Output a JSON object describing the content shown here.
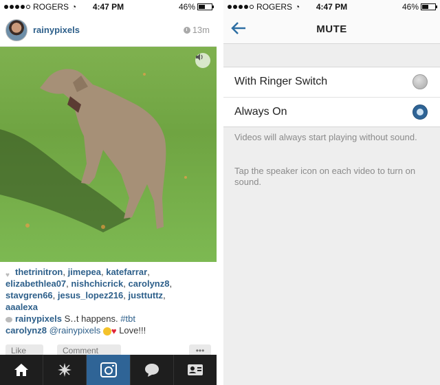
{
  "left_screen": {
    "status_bar": {
      "carrier": "ROGERS",
      "time": "4:47 PM",
      "battery": "46%"
    },
    "post": {
      "username": "rainypixels",
      "age": "13m",
      "likers": [
        "thetrinitron",
        "jimepea",
        "katefarrar",
        "elizabethlea07",
        "nishchicrick",
        "carolynz8",
        "stavgren66",
        "jesus_lopez216",
        "justtuttz",
        "aaalexa"
      ],
      "comments": [
        {
          "user": "rainypixels",
          "text": "S‥t happens.",
          "hashtag": "#tbt"
        },
        {
          "user": "carolynz8",
          "mention": "@rainypixels",
          "text": "Love!!!"
        }
      ],
      "actions": {
        "like": "Like",
        "comment": "Comment",
        "more": "•••"
      }
    },
    "tab_bar": [
      "home-icon",
      "explore-icon",
      "camera-icon",
      "activity-icon",
      "profile-icon"
    ],
    "active_tab": "camera-icon"
  },
  "right_screen": {
    "status_bar": {
      "carrier": "ROGERS",
      "time": "4:47 PM",
      "battery": "46%"
    },
    "nav": {
      "title": "MUTE"
    },
    "options": [
      {
        "label": "With Ringer Switch",
        "selected": false
      },
      {
        "label": "Always On",
        "selected": true
      }
    ],
    "help_text_1": "Videos will always start playing without sound.",
    "help_text_2": "Tap the speaker icon on each video to turn on sound."
  },
  "colors": {
    "accent": "#2f6496",
    "link": "#2d5f8a",
    "tabbar": "#1e1e1e"
  }
}
